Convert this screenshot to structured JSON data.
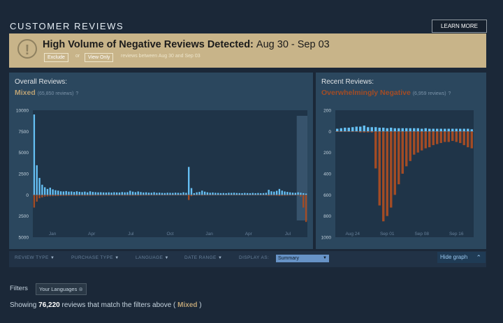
{
  "section": {
    "title": "CUSTOMER REVIEWS",
    "learn_more": "LEARN MORE"
  },
  "alert": {
    "title": "High Volume of Negative Reviews Detected:",
    "range": "Aug 30 - Sep 03",
    "exclude": "Exclude",
    "or": "or",
    "view_only": "View Only",
    "subtext": "reviews between Aug 30 and Sep 03"
  },
  "overall": {
    "label": "Overall Reviews:",
    "score": "Mixed",
    "count": "(65,850 reviews)",
    "score_color": "#b9a074"
  },
  "recent": {
    "label": "Recent Reviews:",
    "score": "Overwhelmingly Negative",
    "count": "(6,959 reviews)",
    "score_color": "#a34c25"
  },
  "filters": {
    "review_type": "REVIEW TYPE",
    "purchase_type": "PURCHASE TYPE",
    "language": "LANGUAGE",
    "date_range": "DATE RANGE",
    "display_as": "DISPLAY AS:",
    "display_value": "Summary",
    "hide_graph": "Hide graph"
  },
  "bottom": {
    "filters_label": "Filters",
    "chip": "Your Languages",
    "showing_prefix": "Showing",
    "count": "76,220",
    "showing_mid": "reviews that match the filters above (",
    "score": "Mixed",
    "showing_suffix": ")"
  },
  "colors": {
    "positive": "#66c0f4",
    "negative": "#a34c25",
    "mixed": "#b9a074"
  },
  "chart_data": [
    {
      "type": "bar",
      "title": "Overall Reviews",
      "y_tick_labels": [
        "10000",
        "7500",
        "5000",
        "2500",
        "0",
        "2500",
        "5000"
      ],
      "y_ticks": [
        10000,
        7500,
        5000,
        2500,
        0,
        -2500,
        -5000
      ],
      "ylim": [
        -5000,
        10000
      ],
      "x_tick_labels": [
        "Jan",
        "Apr",
        "Jul",
        "Oct",
        "Jan",
        "Apr",
        "Jul"
      ],
      "series": [
        {
          "name": "Positive",
          "values": [
            9500,
            3500,
            2000,
            1200,
            900,
            700,
            850,
            650,
            550,
            500,
            420,
            400,
            450,
            380,
            400,
            350,
            420,
            360,
            330,
            380,
            300,
            420,
            350,
            320,
            300,
            310,
            290,
            280,
            300,
            270,
            310,
            290,
            280,
            330,
            300,
            320,
            480,
            380,
            320,
            400,
            330,
            280,
            300,
            260,
            250,
            310,
            240,
            260,
            230,
            220,
            250,
            240,
            230,
            260,
            240,
            220,
            300,
            240,
            3300,
            800,
            200,
            300,
            350,
            500,
            380,
            300,
            250,
            280,
            240,
            230,
            210,
            220,
            200,
            240,
            230,
            250,
            220,
            210,
            200,
            230,
            210,
            200,
            230,
            200,
            220,
            200,
            210,
            240,
            600,
            420,
            380,
            480,
            700,
            500,
            400,
            350,
            300,
            260,
            240,
            300,
            250,
            200,
            150
          ]
        },
        {
          "name": "Negative",
          "values": [
            1500,
            800,
            400,
            300,
            200,
            180,
            160,
            150,
            140,
            130,
            120,
            110,
            110,
            100,
            100,
            100,
            110,
            90,
            90,
            100,
            90,
            100,
            90,
            80,
            80,
            80,
            70,
            70,
            80,
            70,
            80,
            70,
            70,
            80,
            80,
            80,
            90,
            90,
            80,
            90,
            80,
            70,
            70,
            70,
            60,
            70,
            60,
            60,
            60,
            60,
            60,
            60,
            60,
            60,
            60,
            60,
            70,
            60,
            600,
            150,
            60,
            60,
            60,
            80,
            60,
            60,
            60,
            60,
            50,
            50,
            50,
            50,
            50,
            50,
            50,
            50,
            50,
            50,
            50,
            50,
            50,
            50,
            50,
            50,
            50,
            50,
            50,
            60,
            100,
            80,
            80,
            90,
            120,
            100,
            90,
            80,
            70,
            70,
            60,
            70,
            200,
            1500,
            3200,
            2800
          ]
        }
      ],
      "highlight_window": "Aug 30 - Sep 03"
    },
    {
      "type": "bar",
      "title": "Recent Reviews",
      "y_tick_labels": [
        "200",
        "0",
        "200",
        "400",
        "600",
        "800",
        "1000"
      ],
      "y_ticks": [
        200,
        0,
        -200,
        -400,
        -600,
        -800,
        -1000
      ],
      "ylim": [
        -1000,
        200
      ],
      "x_tick_labels": [
        "Aug 24",
        "Sep 01",
        "Sep 08",
        "Sep 16"
      ],
      "series": [
        {
          "name": "Positive",
          "values": [
            25,
            30,
            35,
            35,
            40,
            45,
            45,
            55,
            40,
            40,
            40,
            35,
            35,
            30,
            35,
            30,
            30,
            30,
            30,
            30,
            30,
            30,
            25,
            30,
            25,
            25,
            25,
            25,
            25,
            25,
            25,
            25,
            25,
            25,
            25,
            20
          ]
        },
        {
          "name": "Negative",
          "values": [
            5,
            5,
            5,
            5,
            5,
            5,
            10,
            10,
            10,
            10,
            350,
            700,
            850,
            800,
            720,
            600,
            500,
            400,
            330,
            280,
            220,
            200,
            180,
            160,
            150,
            130,
            120,
            110,
            100,
            100,
            90,
            100,
            110,
            130,
            150,
            160
          ]
        }
      ]
    }
  ]
}
